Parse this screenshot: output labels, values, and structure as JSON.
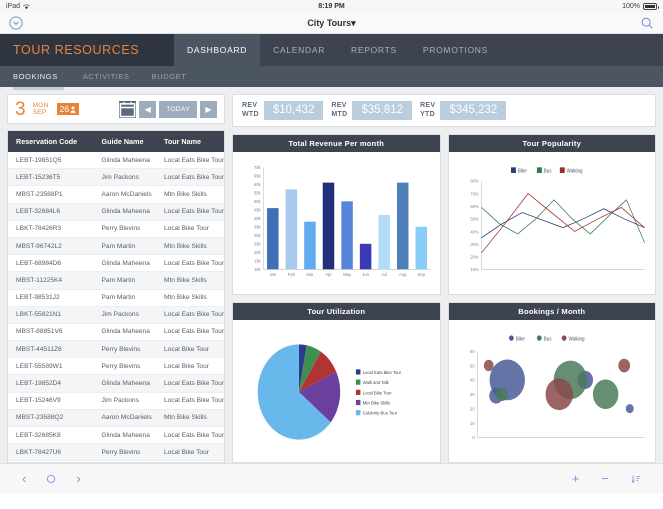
{
  "status_bar": {
    "device": "iPad",
    "wifi_icon": "wifi-icon",
    "time": "8:19 PM",
    "battery_pct": "100%"
  },
  "chrome": {
    "expand_icon": "chevron-down-circle-icon",
    "title": "City Tours",
    "title_caret": "▾",
    "search_icon": "search-icon"
  },
  "header": {
    "brand": "TOUR RESOURCES",
    "tabs": [
      {
        "label": "DASHBOARD",
        "active": true
      },
      {
        "label": "CALENDAR",
        "active": false
      },
      {
        "label": "REPORTS",
        "active": false
      },
      {
        "label": "PROMOTIONS",
        "active": false
      }
    ]
  },
  "sub_nav": {
    "tabs": [
      {
        "label": "BOOKINGS",
        "active": true
      },
      {
        "label": "ACTIVITIES",
        "active": false
      },
      {
        "label": "BUDGET",
        "active": false
      }
    ]
  },
  "date_bar": {
    "day_number": "3",
    "weekday": "MON",
    "month": "SEP",
    "badge_count": "26",
    "badge_icon": "person-icon",
    "calendar_icon": "calendar-icon",
    "prev_icon": "◀",
    "today_label": "TODAY",
    "next_icon": "▶"
  },
  "kpis": [
    {
      "label_top": "REV",
      "label_bottom": "WTD",
      "value": "$10,432"
    },
    {
      "label_top": "REV",
      "label_bottom": "MTD",
      "value": "$35,812"
    },
    {
      "label_top": "REV",
      "label_bottom": "YTD",
      "value": "$345,232"
    }
  ],
  "table": {
    "columns": [
      "Reservation Code",
      "Guide Name",
      "Tour Name"
    ],
    "rows": [
      [
        "LEBT-19851Q5",
        "Glinda Maheena",
        "Local Eats Bike Tour"
      ],
      [
        "LEBT-15236T5",
        "Jim Packons",
        "Local Eats Bike Tour"
      ],
      [
        "MBST-23588P1",
        "Aaron McDaniels",
        "Mtn Bike Skills"
      ],
      [
        "LEBT-32684L6",
        "Glinda Maheena",
        "Local Eats Bike Tour"
      ],
      [
        "LBKT-78426R3",
        "Perry Blevins",
        "Local Bike Tour"
      ],
      [
        "MBST-96742L2",
        "Pam Martin",
        "Mtn Bike Skills"
      ],
      [
        "LEBT-68984D6",
        "Glinda Maheena",
        "Local Eats Bike Tour"
      ],
      [
        "MBST-11225K4",
        "Pam Martin",
        "Mtn Bike Skills"
      ],
      [
        "LEBT-98531J2",
        "Pam Martin",
        "Mtn Bike Skills"
      ],
      [
        "LBKT-55821N1",
        "Jim Packons",
        "Local Eats Bike Tour"
      ],
      [
        "MBST-88851V6",
        "Glinda Maheena",
        "Local Eats Bike Tour"
      ],
      [
        "MBST-44511Z6",
        "Perry Blevins",
        "Local Bike Tour"
      ],
      [
        "LEBT-55589W1",
        "Perry Blevins",
        "Local Bike Tour"
      ],
      [
        "LEBT-19852D4",
        "Glinda Maheena",
        "Local Eats Bike Tour"
      ],
      [
        "LEBT-15246V9",
        "Jim Packons",
        "Local Eats Bike Tour"
      ],
      [
        "MBST-23588Q2",
        "Aaron McDaniels",
        "Mtn Bike Skills"
      ],
      [
        "LEBT-32685K8",
        "Glinda Maheena",
        "Local Eats Bike Tour"
      ],
      [
        "LBKT-78427U6",
        "Perry Blevins",
        "Local Bike Tour"
      ]
    ]
  },
  "cards": {
    "revenue_title": "Total Revenue Per month",
    "popularity_title": "Tour Popularity",
    "utilization_title": "Tour Utilization",
    "bookings_title": "Bookings / Month"
  },
  "bottom_bar": {
    "back_icon": "chevron-left-icon",
    "stop_icon": "circle-icon",
    "forward_icon": "chevron-right-icon",
    "plus_icon": "plus-icon",
    "minus_icon": "minus-icon",
    "sort_icon": "sort-icon"
  },
  "chart_data": [
    {
      "type": "bar",
      "title": "Total Revenue Per month",
      "categories": [
        "Jan",
        "Feb",
        "Mar",
        "Apr",
        "May",
        "Jun",
        "Jul",
        "Aug",
        "Sep"
      ],
      "values": [
        46,
        57,
        38,
        61,
        50,
        25,
        42,
        61,
        35
      ],
      "unit": "k",
      "colors": [
        "#3f6fb5",
        "#a8c9eb",
        "#62aaf0",
        "#22307c",
        "#5786d8",
        "#3a3ab5",
        "#b2dcf7",
        "#4f7fb8",
        "#87cdf5"
      ],
      "ylim": [
        10,
        70
      ],
      "yticks": [
        "70k",
        "65k",
        "60k",
        "55k",
        "50k",
        "45k",
        "40k",
        "35k",
        "30k",
        "25k",
        "20k",
        "15k",
        "10k"
      ],
      "xlabel": "",
      "ylabel": "",
      "grid": false
    },
    {
      "type": "line",
      "title": "Tour Popularity",
      "x": [
        "1",
        "2",
        "3",
        "4",
        "5",
        "6",
        "7",
        "8",
        "9"
      ],
      "series": [
        {
          "name": "Bike",
          "color": "#2b3a7a",
          "values": [
            35,
            46,
            55,
            49,
            43,
            50,
            58,
            50,
            43
          ]
        },
        {
          "name": "Bus",
          "color": "#2f7a4a",
          "values": [
            59,
            46,
            38,
            50,
            65,
            50,
            38,
            52,
            65,
            31
          ]
        },
        {
          "name": "Walking",
          "color": "#9e2b2b",
          "values": [
            23,
            46,
            70,
            55,
            40,
            50,
            59,
            43
          ]
        }
      ],
      "ylim": [
        10,
        80
      ],
      "yticks": [
        "80%",
        "70%",
        "60%",
        "50%",
        "40%",
        "30%",
        "20%",
        "10%"
      ],
      "legend_position": "top",
      "grid": false
    },
    {
      "type": "pie",
      "title": "Tour Utilization",
      "labels": [
        "Local Eats Bike Tour",
        "Walk and Talk",
        "Local Bike Tour",
        "Mtn Bike Skills",
        "Celebrity Bus Tour"
      ],
      "values": [
        3,
        6,
        9,
        18,
        64
      ],
      "colors": [
        "#2b3a8c",
        "#3f8f4f",
        "#b03434",
        "#6b3f9e",
        "#69b8ec"
      ],
      "legend_position": "right"
    },
    {
      "type": "scatter",
      "title": "Bookings / Month",
      "series": [
        {
          "name": "Bike",
          "color": "#4a5a96",
          "points": [
            [
              1.0,
              29,
              7
            ],
            [
              1.6,
              40,
              18
            ],
            [
              5.8,
              40,
              8
            ],
            [
              8.2,
              20,
              4
            ]
          ]
        },
        {
          "name": "Bus",
          "color": "#4a7a5a",
          "points": [
            [
              1.3,
              30,
              6
            ],
            [
              5.0,
              40,
              17
            ],
            [
              6.9,
              30,
              13
            ]
          ]
        },
        {
          "name": "Walking",
          "color": "#8a4a4a",
          "points": [
            [
              0.6,
              50,
              5
            ],
            [
              4.4,
              30,
              14
            ],
            [
              7.9,
              50,
              6
            ]
          ]
        }
      ],
      "ylim": [
        0,
        60
      ],
      "yticks": [
        "60",
        "50",
        "40",
        "30",
        "20",
        "10",
        "0"
      ],
      "legend_position": "top",
      "grid": false
    }
  ]
}
